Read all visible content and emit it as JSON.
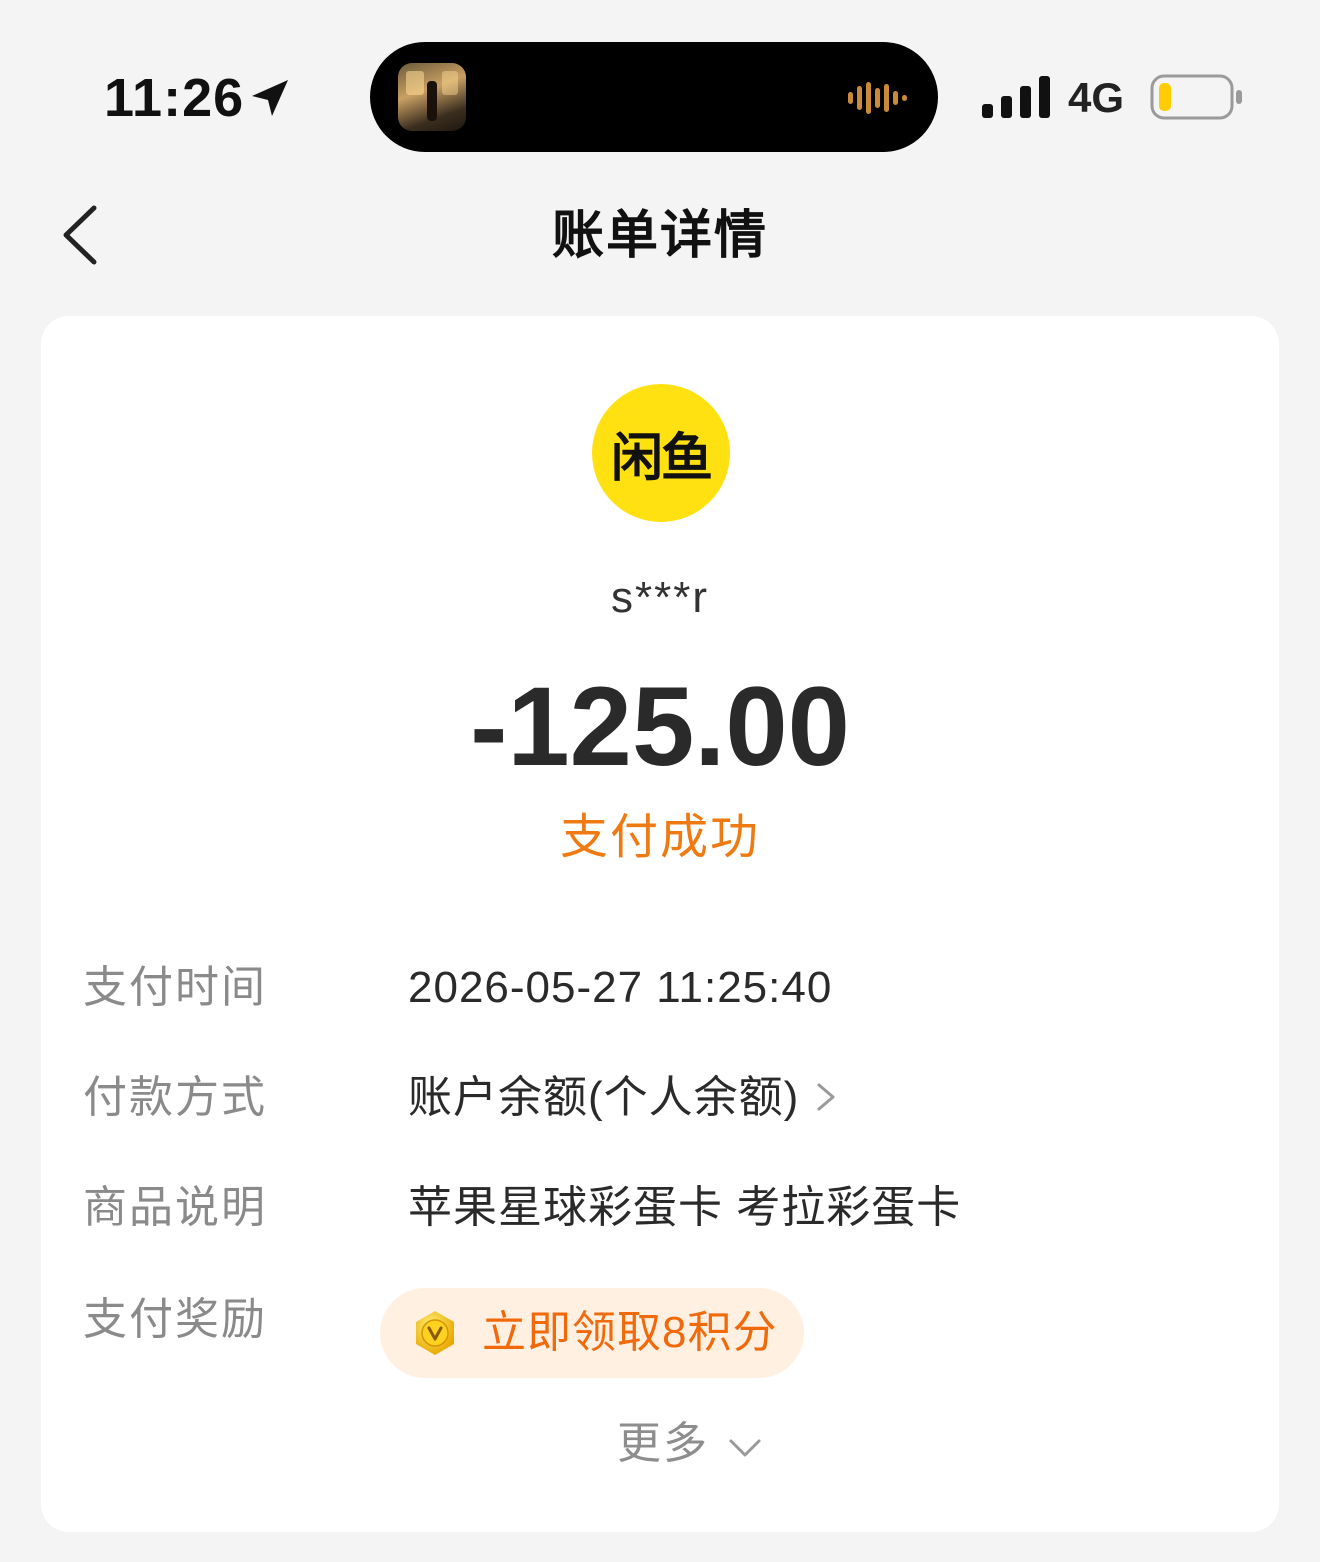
{
  "status_bar": {
    "time": "11:26",
    "network": "4G",
    "icons": [
      "location-arrow-icon",
      "audio-wave-icon",
      "signal-bars-icon",
      "battery-icon"
    ],
    "battery_level": 0.15,
    "battery_color": "#ffcc00"
  },
  "nav": {
    "title": "账单详情",
    "back_icon": "chevron-left-icon"
  },
  "bill": {
    "merchant_logo_text": "闲鱼",
    "merchant_logo_color": "#ffe011",
    "merchant_name": "s***r",
    "amount": "-125.00",
    "status": "支付成功",
    "status_color": "#ef7a12",
    "rows": [
      {
        "label": "支付时间",
        "value": "2026-05-27 11:25:40"
      },
      {
        "label": "付款方式",
        "value": "账户余额(个人余额)"
      },
      {
        "label": "商品说明",
        "value": "苹果星球彩蛋卡 考拉彩蛋卡"
      },
      {
        "label": "支付奖励",
        "value": "立即领取8积分"
      }
    ],
    "more_label": "更多"
  }
}
